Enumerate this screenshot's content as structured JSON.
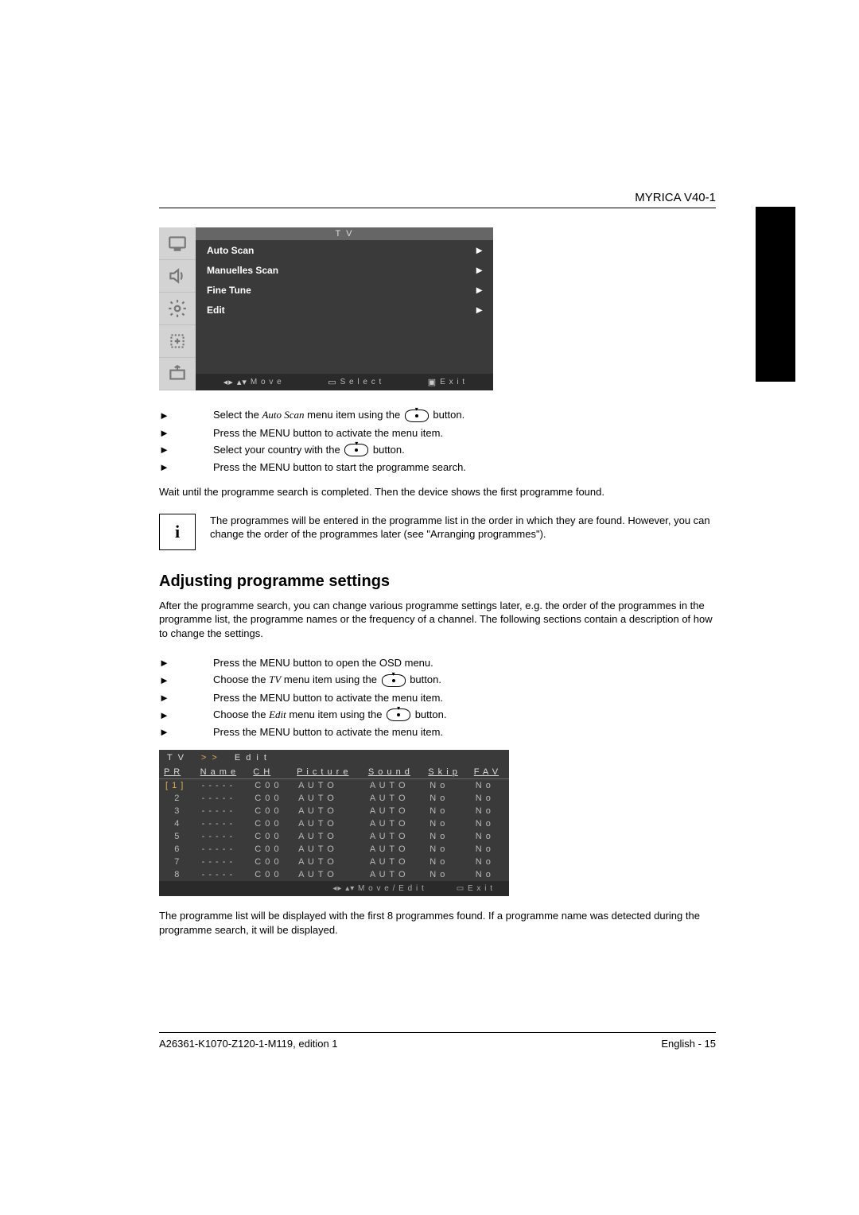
{
  "header": {
    "product": "MYRICA V40-1"
  },
  "osd": {
    "title": "T V",
    "items": [
      {
        "label": "Auto Scan"
      },
      {
        "label": "Manuelles Scan"
      },
      {
        "label": "Fine Tune"
      },
      {
        "label": "Edit"
      }
    ],
    "footer": {
      "move": "M o v e",
      "select": "S e l e c t",
      "exit": "E x i t"
    }
  },
  "instr1": {
    "i0a": "Select the ",
    "i0b": "Auto Scan",
    "i0c": " menu item using the ",
    "i0d": " button.",
    "i1": "Press the MENU button to activate the menu item.",
    "i2a": "Select your country with the ",
    "i2b": " button.",
    "i3": "Press the MENU button to start the programme search."
  },
  "wait_line": "Wait until the programme search is completed. Then the device shows the first programme found.",
  "info1": "The programmes will be entered in the programme list in the order in which they are found. However, you can change the order of the programmes later (see \"Arranging programmes\").",
  "section_title": "Adjusting programme settings",
  "section_intro": "After the programme search, you can change various programme settings later, e.g. the order of the programmes in the programme list, the programme names or the frequency of a channel. The following sections contain a description of how to change the settings.",
  "instr2": {
    "i0": "Press the MENU button to open the OSD menu.",
    "i1a": "Choose the ",
    "i1b": "TV",
    "i1c": " menu item using the ",
    "i1d": " button.",
    "i2": "Press the MENU button to activate the menu item.",
    "i3a": "Choose the ",
    "i3b": "Edit",
    "i3c": " menu item using the ",
    "i3d": " button.",
    "i4": "Press the MENU button to activate the menu item."
  },
  "edit": {
    "crumb1": "T V",
    "crumb2": "E d i t",
    "headers": {
      "PR": "P R",
      "Name": "N a m e",
      "CH": "C H",
      "Picture": "P i c t u r e",
      "Sound": "S o u n d",
      "Skip": "S k i p",
      "FAV": "F A V"
    },
    "rows": [
      {
        "pr": "[ 1 ]",
        "name": "- - - - -",
        "ch": "C 0 0",
        "picture": "A U T O",
        "sound": "A U T O",
        "skip": "N o",
        "fav": "N o",
        "sel": true
      },
      {
        "pr": "2",
        "name": "- - - - -",
        "ch": "C 0 0",
        "picture": "A U T O",
        "sound": "A U T O",
        "skip": "N o",
        "fav": "N o"
      },
      {
        "pr": "3",
        "name": "- - - - -",
        "ch": "C 0 0",
        "picture": "A U T O",
        "sound": "A U T O",
        "skip": "N o",
        "fav": "N o"
      },
      {
        "pr": "4",
        "name": "- - - - -",
        "ch": "C 0 0",
        "picture": "A U T O",
        "sound": "A U T O",
        "skip": "N o",
        "fav": "N o"
      },
      {
        "pr": "5",
        "name": "- - - - -",
        "ch": "C 0 0",
        "picture": "A U T O",
        "sound": "A U T O",
        "skip": "N o",
        "fav": "N o"
      },
      {
        "pr": "6",
        "name": "- - - - -",
        "ch": "C 0 0",
        "picture": "A U T O",
        "sound": "A U T O",
        "skip": "N o",
        "fav": "N o"
      },
      {
        "pr": "7",
        "name": "- - - - -",
        "ch": "C 0 0",
        "picture": "A U T O",
        "sound": "A U T O",
        "skip": "N o",
        "fav": "N o"
      },
      {
        "pr": "8",
        "name": "- - - - -",
        "ch": "C 0 0",
        "picture": "A U T O",
        "sound": "A U T O",
        "skip": "N o",
        "fav": "N o"
      }
    ],
    "footer": {
      "move": "M o v e / E d i t",
      "exit": "E x i t"
    }
  },
  "after_edit": "The programme list will be displayed with the first 8 programmes found. If a programme name was detected during the programme search, it will be displayed.",
  "footer": {
    "left": "A26361-K1070-Z120-1-M119, edition 1",
    "right": "English - 15"
  }
}
